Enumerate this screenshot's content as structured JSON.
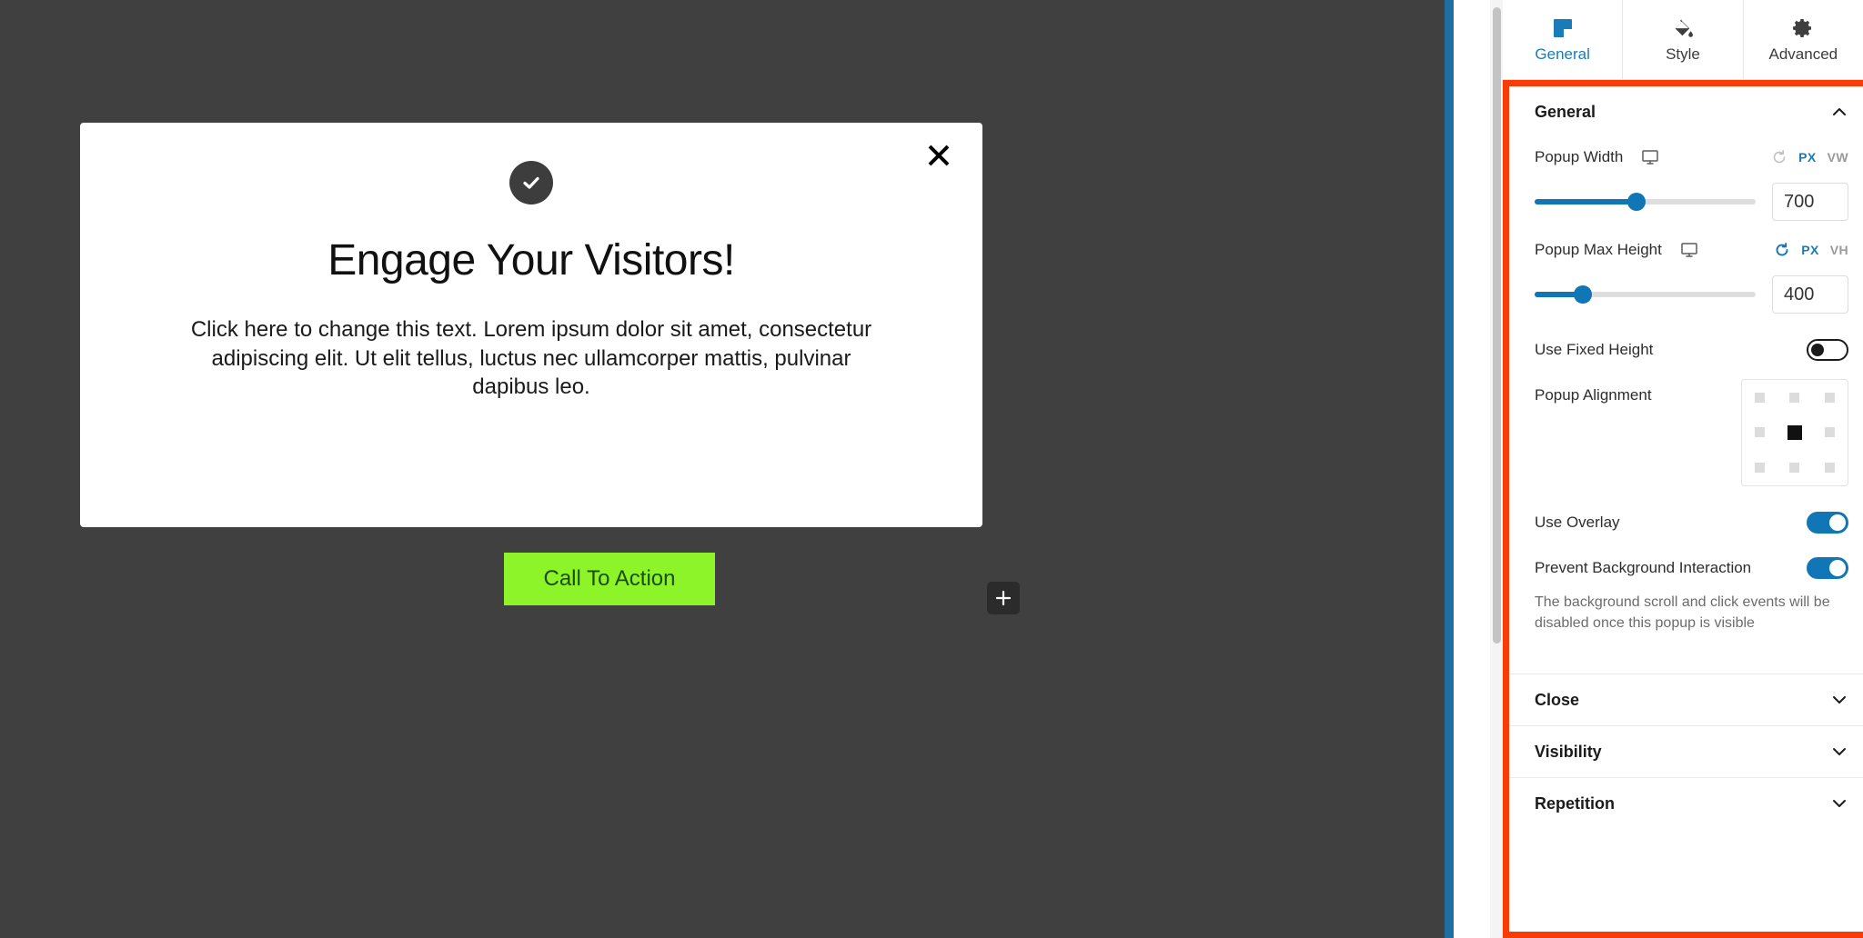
{
  "canvas": {
    "background_color": "#404040",
    "rail_color": "#1e6f9f"
  },
  "popup": {
    "close_icon": "close-x-icon",
    "badge_icon": "check-circle-icon",
    "title": "Engage Your Visitors!",
    "body": "Click here to change this text. Lorem ipsum dolor sit amet, consectetur adipiscing elit. Ut elit tellus, luctus nec ullamcorper mattis, pulvinar dapibus leo.",
    "cta_label": "Call To Action",
    "cta_bg_color": "#8CF428",
    "cta_text_color": "#1c4d05",
    "add_block_icon": "plus-icon"
  },
  "sidebar": {
    "tabs": [
      {
        "label": "General",
        "icon": "layout-square-icon",
        "active": true
      },
      {
        "label": "Style",
        "icon": "paint-bucket-icon",
        "active": false
      },
      {
        "label": "Advanced",
        "icon": "gear-icon",
        "active": false
      }
    ],
    "accent_color": "#1a7bb9",
    "highlight_border_color": "#f93c06",
    "sections": {
      "general": {
        "title": "General",
        "expanded": true,
        "chevron": "chevron-up-icon",
        "fields": {
          "popup_width": {
            "label": "Popup Width",
            "device_icon": "desktop-monitor-icon",
            "reset_icon": "reset-icon",
            "reset_active": false,
            "units": [
              "PX",
              "VW"
            ],
            "active_unit": "PX",
            "value": "700",
            "slider_percent": 46
          },
          "popup_max_height": {
            "label": "Popup Max Height",
            "device_icon": "desktop-monitor-icon",
            "reset_icon": "reset-icon",
            "reset_active": true,
            "units": [
              "PX",
              "VH"
            ],
            "active_unit": "PX",
            "value": "400",
            "slider_percent": 22
          },
          "use_fixed_height": {
            "label": "Use Fixed Height",
            "state": "off"
          },
          "popup_alignment": {
            "label": "Popup Alignment",
            "cells": [
              "top-left",
              "top-center",
              "top-right",
              "middle-left",
              "middle-center",
              "middle-right",
              "bottom-left",
              "bottom-center",
              "bottom-right"
            ],
            "selected_index": 4
          },
          "use_overlay": {
            "label": "Use Overlay",
            "state": "on"
          },
          "prevent_background_interaction": {
            "label": "Prevent Background Interaction",
            "state": "on",
            "help": "The background scroll and click events will be disabled once this popup is visible"
          }
        }
      },
      "collapsed": [
        {
          "title": "Close",
          "chevron": "chevron-down-icon"
        },
        {
          "title": "Visibility",
          "chevron": "chevron-down-icon"
        },
        {
          "title": "Repetition",
          "chevron": "chevron-down-icon"
        }
      ]
    }
  }
}
